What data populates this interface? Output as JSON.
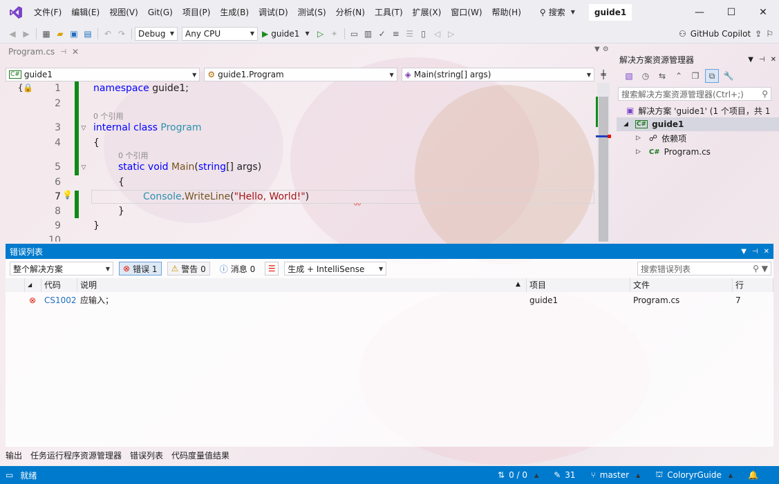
{
  "menu": {
    "items": [
      "文件(F)",
      "编辑(E)",
      "视图(V)",
      "Git(G)",
      "项目(P)",
      "生成(B)",
      "调试(D)",
      "测试(S)",
      "分析(N)",
      "工具(T)",
      "扩展(X)",
      "窗口(W)",
      "帮助(H)"
    ],
    "search_label": "搜索",
    "solution_title": "guide1"
  },
  "toolbar": {
    "config": "Debug",
    "platform": "Any CPU",
    "run_target": "guide1",
    "copilot": "GitHub Copilot"
  },
  "doc_tab": {
    "name": "Program.cs"
  },
  "nav": {
    "project": "guide1",
    "class": "guide1.Program",
    "member": "Main(string[] args)"
  },
  "editor": {
    "line_numbers": [
      "1",
      "2",
      "3",
      "4",
      "5",
      "6",
      "7",
      "8",
      "9",
      "10"
    ],
    "lens": "0 个引用",
    "code": {
      "l1_kw": "namespace",
      "l1_rest": " guide1;",
      "l3_kw1": "internal",
      "l3_kw2": " class",
      "l3_ty": " Program",
      "brace_open": "{",
      "l5_kw1": "static",
      "l5_kw2": " void",
      "l5_mt": " Main",
      "l5_p1": "(",
      "l5_kw3": "string",
      "l5_p2": "[] args)",
      "l7_ty": "Console",
      "l7_dot": ".",
      "l7_mt": "WriteLine",
      "l7_p1": "(",
      "l7_st": "\"Hello, World!\"",
      "l7_p2": ")",
      "brace_close": "}"
    }
  },
  "solution_explorer": {
    "title": "解决方案资源管理器",
    "search_placeholder": "搜索解决方案资源管理器(Ctrl+;)",
    "solution": "解决方案 'guide1' (1 个项目，共 1",
    "project": "guide1",
    "dependencies": "依赖项",
    "file": "Program.cs"
  },
  "error_list": {
    "title": "错误列表",
    "scope": "整个解决方案",
    "errors_label": "错误 1",
    "warnings_label": "警告 0",
    "messages_label": "消息 0",
    "build_filter": "生成 + IntelliSense",
    "search_placeholder": "搜索错误列表",
    "columns": [
      "代码",
      "说明",
      "项目",
      "文件",
      "行"
    ],
    "rows": [
      {
        "code": "CS1002",
        "desc": "应输入；",
        "project": "guide1",
        "file": "Program.cs",
        "line": "7"
      }
    ]
  },
  "bottom_tabs": [
    "输出",
    "任务运行程序资源管理器",
    "错误列表",
    "代码度量值结果"
  ],
  "status": {
    "ready": "就绪",
    "sync": "0 / 0",
    "edits": "31",
    "branch": "master",
    "repo": "ColoryrGuide"
  },
  "colors": {
    "accent": "#007acc",
    "change_bar": "#108a16",
    "error": "#e51400"
  }
}
